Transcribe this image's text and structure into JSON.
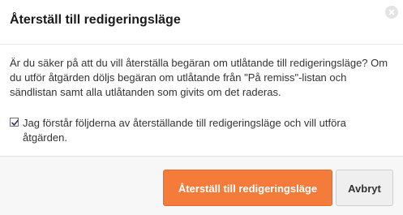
{
  "dialog": {
    "title": "Återställ till redigeringsläge",
    "message": "Är du säker på att du vill återställa begäran om utlåtande till redigeringsläge? Om du utför åtgärden döljs begäran om utlåtande från \"På remiss\"-listan och sändlistan samt alla utlåtanden som givits om det raderas.",
    "confirm_checkbox": {
      "checked": true,
      "label": "Jag förstår följderna av återställande till redigeringsläge och vill utföra åtgärden."
    },
    "buttons": {
      "confirm_label": "Återställ till redigeringsläge",
      "cancel_label": "Avbryt"
    },
    "icons": {
      "close": "close-icon",
      "checkmark": "checkmark-icon"
    },
    "colors": {
      "primary": "#f47b3a",
      "secondary": "#efefef"
    }
  }
}
